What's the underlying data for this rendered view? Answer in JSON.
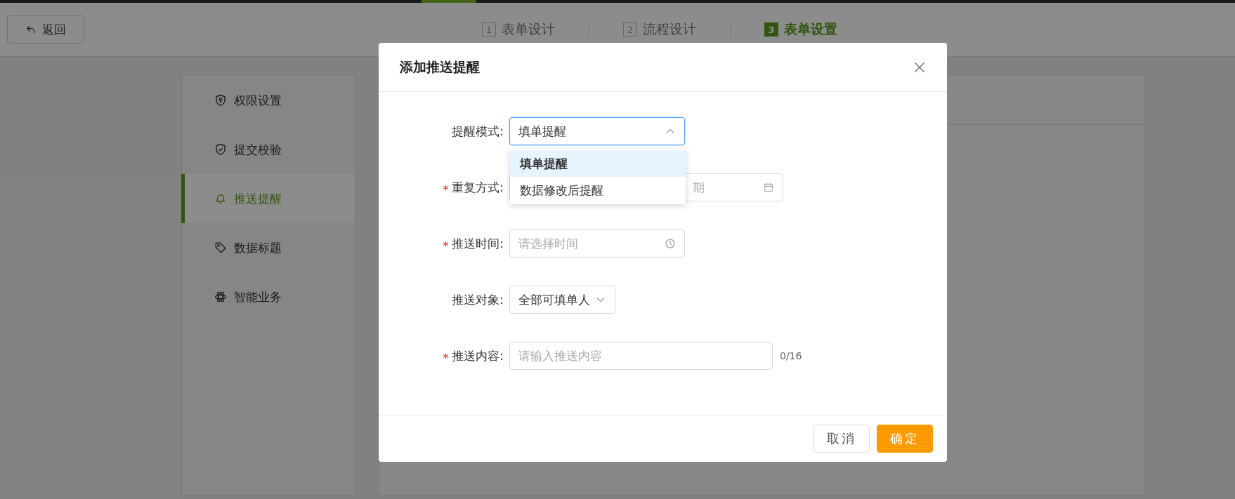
{
  "header": {
    "back_button": "返回",
    "steps": [
      {
        "number": "1",
        "label": "表单设计",
        "selected": false
      },
      {
        "number": "2",
        "label": "流程设计",
        "selected": false
      },
      {
        "number": "3",
        "label": "表单设置",
        "selected": true
      }
    ]
  },
  "sidebar": {
    "items": [
      {
        "label": "权限设置",
        "selected": false
      },
      {
        "label": "提交校验",
        "selected": false
      },
      {
        "label": "推送提醒",
        "selected": true
      },
      {
        "label": "数据标题",
        "selected": false
      },
      {
        "label": "智能业务",
        "selected": false
      }
    ]
  },
  "modal": {
    "title": "添加推送提醒",
    "fields": [
      {
        "kind": "select",
        "label": "提醒模式:",
        "required": false,
        "value": "填单提醒",
        "expanded": true,
        "options": [
          {
            "label": "填单提醒",
            "selected": true
          },
          {
            "label": "数据修改后提醒",
            "selected": false
          }
        ]
      },
      {
        "kind": "date",
        "label": "重复方式:",
        "required": true,
        "placeholder": "期"
      },
      {
        "kind": "time",
        "label": "推送时间:",
        "required": true,
        "placeholder": "请选择时间"
      },
      {
        "kind": "small-select",
        "label": "推送对象:",
        "required": false,
        "value": "全部可填单人"
      },
      {
        "kind": "text",
        "label": "推送内容:",
        "required": true,
        "placeholder": "请输入推送内容",
        "counter": "0/16"
      }
    ],
    "buttons": [
      {
        "kind": "secondary",
        "label": "取消"
      },
      {
        "kind": "primary",
        "label": "确定"
      }
    ]
  }
}
